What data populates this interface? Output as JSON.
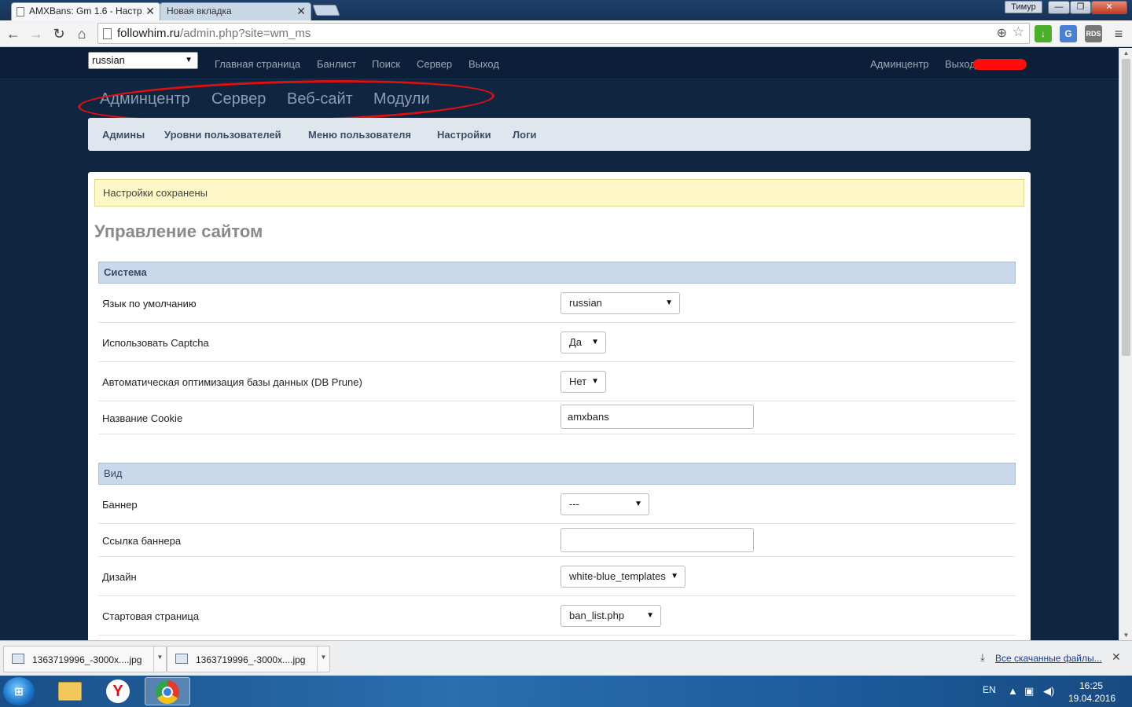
{
  "browser": {
    "tabs": [
      {
        "label": "AMXBans: Gm 1.6 - Настр",
        "active": true
      },
      {
        "label": "Новая вкладка",
        "active": false
      }
    ],
    "user_badge": "Тимур",
    "url_host": "followhim.ru",
    "url_path": "/admin.php?site=wm_ms",
    "window_buttons": {
      "minimize": "—",
      "maximize": "❐",
      "close": "✕"
    }
  },
  "topbar": {
    "language": "russian",
    "nav_left": [
      "Главная страница",
      "Банлист",
      "Поиск",
      "Сервер",
      "Выход"
    ],
    "nav_right": [
      "Админцентр",
      "Выход"
    ]
  },
  "main_menu": [
    "Админцентр",
    "Сервер",
    "Веб-сайт",
    "Модули"
  ],
  "sub_menu": [
    "Админы",
    "Уровни пользователей",
    "Меню пользователя",
    "Настройки",
    "Логи"
  ],
  "alert": "Настройки сохранены",
  "page_title": "Управление сайтом",
  "sections": {
    "system": {
      "title": "Система",
      "rows": [
        {
          "label": "Язык по умолчанию",
          "type": "select",
          "value": "russian"
        },
        {
          "label": "Использовать Captcha",
          "type": "select",
          "value": "Да"
        },
        {
          "label": "Автоматическая оптимизация базы данных (DB Prune)",
          "type": "select",
          "value": "Нет"
        },
        {
          "label": "Название Cookie",
          "type": "text",
          "value": "amxbans"
        }
      ]
    },
    "view": {
      "title": "Вид",
      "rows": [
        {
          "label": "Баннер",
          "type": "select",
          "value": "---"
        },
        {
          "label": "Ссылка баннера",
          "type": "text",
          "value": ""
        },
        {
          "label": "Дизайн",
          "type": "select",
          "value": "white-blue_templates"
        },
        {
          "label": "Стартовая страница",
          "type": "select",
          "value": "ban_list.php"
        }
      ]
    }
  },
  "downloads": {
    "items": [
      "1363719996_-3000x....jpg",
      "1363719996_-3000x....jpg"
    ],
    "show_all": "Все скачанные файлы..."
  },
  "taskbar": {
    "language": "EN",
    "time": "16:25",
    "date": "19.04.2016"
  },
  "colors": {
    "page_background": "#0f2540",
    "submenu_background": "#dfe6ee",
    "section_header": "#c9d8ea",
    "alert_background": "#fdf8c6",
    "annotation_red": "#e01010"
  }
}
